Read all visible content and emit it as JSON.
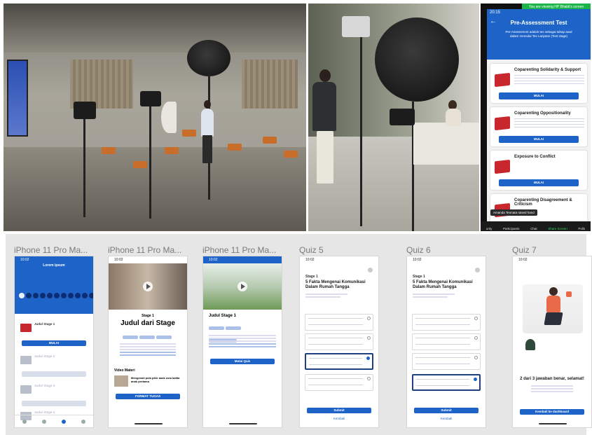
{
  "zoom": {
    "banner": "You are viewing HP Bhakti's screen",
    "clock": "20:15",
    "title": "Pre-Assessment Test",
    "subtitle": "Pre-Assessment adalah tes sebagai tahap awal dalam memulai Tes Lanjutan (Test stage)",
    "cards": [
      {
        "title": "Coparenting Solidarity & Support",
        "button": "MULAI"
      },
      {
        "title": "Coparenting Oppositionality",
        "button": "MULAI"
      },
      {
        "title": "Exposure to Conflict",
        "button": "MULAI"
      },
      {
        "title": "Coparenting Disagreement & Criticism",
        "button": "MULAI"
      }
    ],
    "toast": "Amanda Teonata raised hand",
    "toolbar": [
      "urity",
      "Participants",
      "Chat",
      "Share Screen",
      "Polls"
    ]
  },
  "canvas": {
    "frames": [
      {
        "label": "iPhone 11 Pro Ma...",
        "clock": "10:02",
        "heading": "Lorem ipsum",
        "items": [
          "Judul Stage 1",
          "Judul Stage 2",
          "Judul Stage 3",
          "Judul Stage 4"
        ],
        "button": "MULAI"
      },
      {
        "label": "iPhone 11 Pro Ma...",
        "clock": "10:02",
        "stage": "Stage 1",
        "heading": "Judul dari Stage",
        "section": "Video Materi",
        "video_title": "Mengenali pola pikir anak usia balita anak pertama",
        "button": "FORMAT TUGAS"
      },
      {
        "label": "iPhone 11 Pro Ma...",
        "clock": "10:02",
        "heading": "Judul Stage 1",
        "button": "Mulai Quiz"
      },
      {
        "label": "Quiz 5",
        "clock": "10:02",
        "stage": "Stage 1",
        "heading": "5 Fakta Mengenai Komunikasi Dalam Rumah Tangga",
        "button": "Submit",
        "link": "Kembali"
      },
      {
        "label": "Quiz 6",
        "clock": "10:02",
        "stage": "Stage 1",
        "heading": "5 Fakta Mengenai Komunikasi Dalam Rumah Tangga",
        "button": "Submit",
        "link": "Kembali"
      },
      {
        "label": "Quiz 7",
        "clock": "10:02",
        "heading": "2 dari 3 jawaban benar, selamat!",
        "button": "Kembali ke dashboard"
      }
    ]
  }
}
